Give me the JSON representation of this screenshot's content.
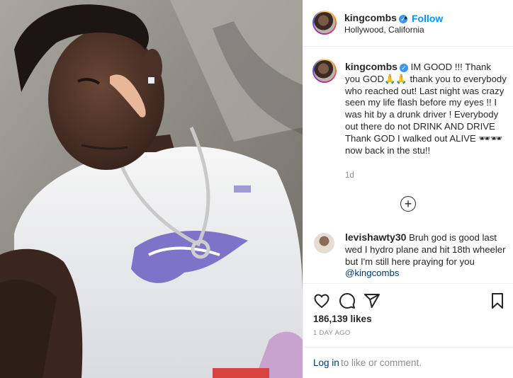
{
  "header": {
    "username": "kingcombs",
    "verified_mark": "✓",
    "separator": "•",
    "follow_label": "Follow",
    "location": "Hollywood, California"
  },
  "caption": {
    "username": "kingcombs",
    "text": "IM GOOD !!! Thank you GOD🙏🙏 thank you to everybody who reached out! Last night was crazy seen my life flash before my eyes !! I was hit by a drunk driver ! Everybody out there do not DRINK AND DRIVE Thank GOD I walked out ALIVE 🕶🕶 now back in the stu!!",
    "time": "1d"
  },
  "load_more": {
    "icon": "plus-circle-icon",
    "symbol": "+"
  },
  "comment": {
    "username": "levishawty30",
    "text": "Bruh god is good last wed I hydro plane and hit 18th wheeler but I'm still here praying for you ",
    "mention": "@kingcombs"
  },
  "actions": {
    "icons": [
      "heart-icon",
      "comment-icon",
      "share-icon",
      "bookmark-icon"
    ],
    "likes": "186,139 likes",
    "date": "1 DAY AGO"
  },
  "login": {
    "link": "Log in",
    "rest": "to like or comment."
  },
  "colors": {
    "accent": "#0095f6",
    "verified": "#3897f0",
    "text": "#262626",
    "muted": "#8e8e8e",
    "link": "#00376b"
  }
}
